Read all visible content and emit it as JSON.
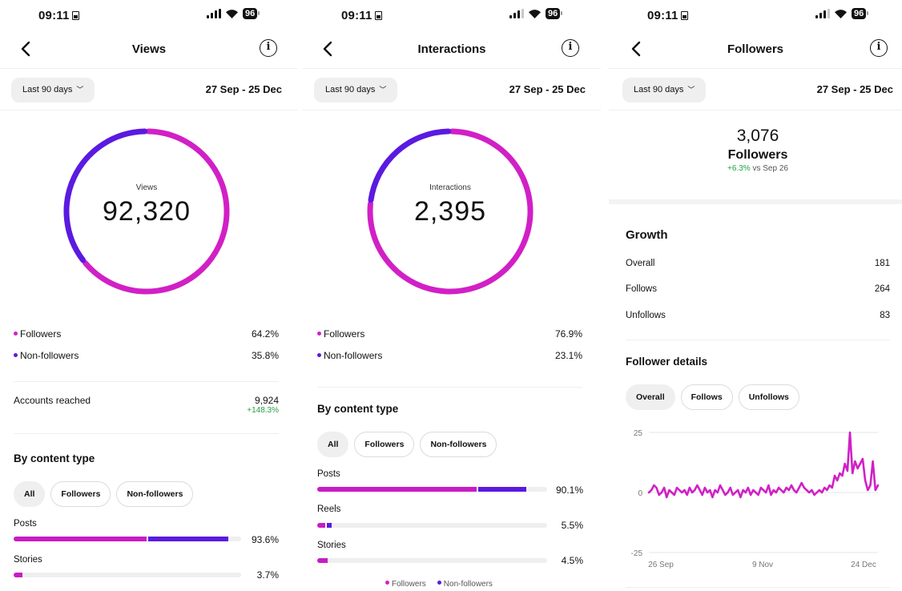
{
  "colors": {
    "followers": "#d120c6",
    "non_followers": "#5b1ae0",
    "positive": "#26a046"
  },
  "status_bar": {
    "time": "09:11",
    "battery": "96"
  },
  "screens": [
    {
      "title": "Views",
      "range_button": "Last 90 days",
      "date_range": "27 Sep - 25 Dec",
      "donut": {
        "label": "Views",
        "value": "92,320",
        "followers_pct": 64.2,
        "non_followers_pct": 35.8
      },
      "legend": [
        {
          "label": "Followers",
          "value": "64.2%"
        },
        {
          "label": "Non-followers",
          "value": "35.8%"
        }
      ],
      "accounts_reached": {
        "label": "Accounts reached",
        "value": "9,924",
        "change": "+148.3%"
      },
      "by_content_type": {
        "title": "By content type",
        "chips": [
          "All",
          "Followers",
          "Non-followers"
        ],
        "rows": [
          {
            "label": "Posts",
            "value": "93.6%",
            "followers_pct": 58.4,
            "non_followers_pct": 35.2
          },
          {
            "label": "Stories",
            "value": "3.7%",
            "followers_pct": 3.7,
            "non_followers_pct": 0
          }
        ]
      }
    },
    {
      "title": "Interactions",
      "range_button": "Last 90 days",
      "date_range": "27 Sep - 25 Dec",
      "donut": {
        "label": "Interactions",
        "value": "2,395",
        "followers_pct": 76.9,
        "non_followers_pct": 23.1
      },
      "legend": [
        {
          "label": "Followers",
          "value": "76.9%"
        },
        {
          "label": "Non-followers",
          "value": "23.1%"
        }
      ],
      "by_content_type": {
        "title": "By content type",
        "chips": [
          "All",
          "Followers",
          "Non-followers"
        ],
        "rows": [
          {
            "label": "Posts",
            "value": "90.1%",
            "followers_pct": 69.3,
            "non_followers_pct": 20.8
          },
          {
            "label": "Reels",
            "value": "5.5%",
            "followers_pct": 3.4,
            "non_followers_pct": 2.1
          },
          {
            "label": "Stories",
            "value": "4.5%",
            "followers_pct": 4.5,
            "non_followers_pct": 0
          }
        ],
        "legend": [
          "Followers",
          "Non-followers"
        ]
      }
    },
    {
      "title": "Followers",
      "range_button": "Last 90 days",
      "date_range": "27 Sep - 25 Dec",
      "summary": {
        "value": "3,076",
        "label": "Followers",
        "change": "+6.3%",
        "change_suffix": "vs Sep 26"
      },
      "growth": {
        "title": "Growth",
        "rows": [
          {
            "label": "Overall",
            "value": "181"
          },
          {
            "label": "Follows",
            "value": "264"
          },
          {
            "label": "Unfollows",
            "value": "83"
          }
        ]
      },
      "follower_details": {
        "title": "Follower details",
        "chips": [
          "Overall",
          "Follows",
          "Unfollows"
        ]
      }
    }
  ],
  "chart_data": {
    "type": "line",
    "title": "",
    "xlabel": "",
    "ylabel": "",
    "ylim": [
      -25,
      25
    ],
    "y_ticks": [
      "25",
      "0",
      "-25"
    ],
    "x_tick_labels": [
      "26 Sep",
      "9 Nov",
      "24 Dec"
    ],
    "series": [
      {
        "name": "Overall",
        "values": [
          0,
          1,
          3,
          2,
          -1,
          0,
          2,
          -2,
          1,
          0,
          -1,
          2,
          1,
          0,
          1,
          -1,
          2,
          0,
          1,
          3,
          1,
          -1,
          2,
          0,
          1,
          -2,
          1,
          0,
          3,
          1,
          -1,
          0,
          2,
          -1,
          0,
          1,
          -2,
          1,
          0,
          2,
          -1,
          1,
          0,
          -1,
          2,
          1,
          0,
          3,
          -1,
          1,
          0,
          2,
          1,
          0,
          2,
          1,
          3,
          1,
          0,
          2,
          4,
          2,
          1,
          0,
          1,
          -1,
          0,
          1,
          0,
          2,
          1,
          3,
          2,
          7,
          5,
          8,
          7,
          12,
          9,
          25,
          8,
          13,
          10,
          12,
          14,
          5,
          1,
          3,
          13,
          1,
          3
        ]
      }
    ]
  }
}
